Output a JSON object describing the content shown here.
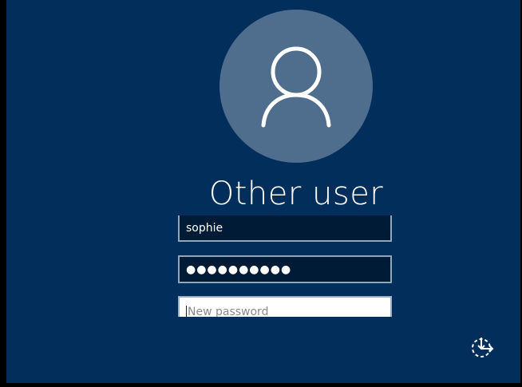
{
  "login": {
    "title": "Other user",
    "username_value": "sophie",
    "password_mask": "●●●●●●●●●●",
    "new_password_placeholder": "New password"
  },
  "icons": {
    "avatar": "user-silhouette-icon",
    "ease_of_access": "ease-of-access-icon"
  },
  "colors": {
    "background": "#012e5a",
    "avatar_circle": "#4f6e8e",
    "field_dark": "#001b36",
    "field_border": "#8fa6bd"
  }
}
